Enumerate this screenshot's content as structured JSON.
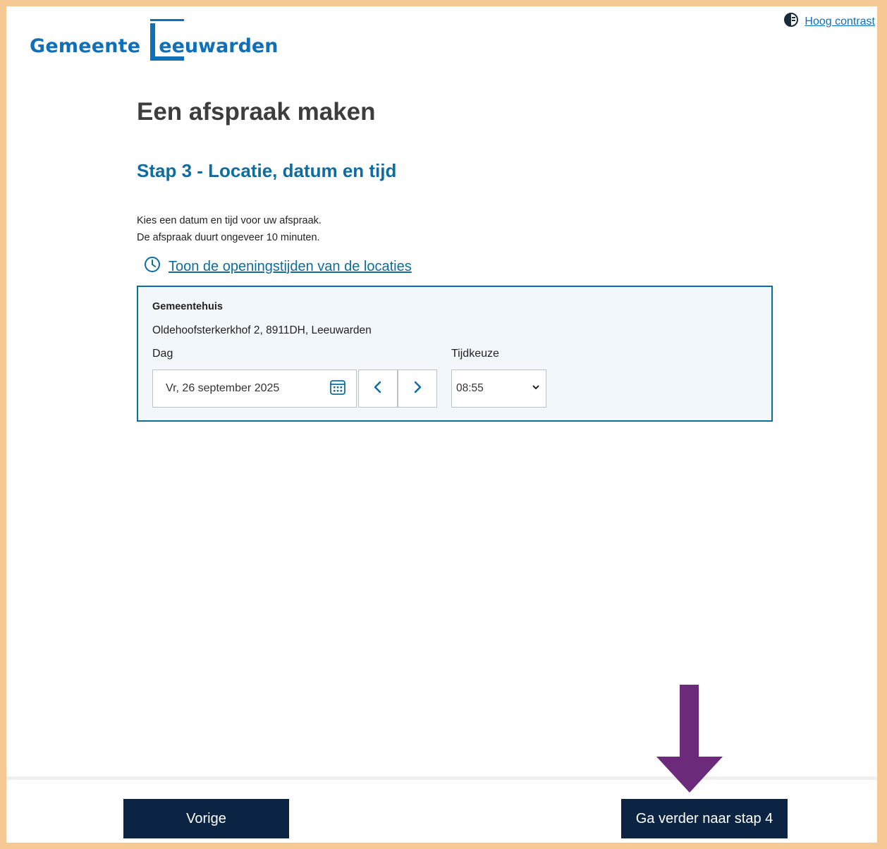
{
  "header": {
    "logo_part1": "Gemeente",
    "logo_part2": "eeuwarden",
    "contrast_link": "Hoog contrast"
  },
  "main": {
    "title": "Een afspraak maken",
    "step_title": "Stap 3 - Locatie, datum en tijd",
    "intro_line1": "Kies een datum en tijd voor uw afspraak.",
    "intro_line2": "De afspraak duurt ongeveer 10 minuten.",
    "hours_link": "Toon de openingstijden van de locaties"
  },
  "location": {
    "name": "Gemeentehuis",
    "address": "Oldehoofsterkerkhof 2, 8911DH, Leeuwarden",
    "day_label": "Dag",
    "day_value": "Vr, 26 september 2025",
    "time_label": "Tijdkeuze",
    "time_value": "08:55"
  },
  "footer": {
    "back_label": "Vorige",
    "next_label": "Ga verder naar stap 4"
  },
  "colors": {
    "brand_blue": "#0f6fb7",
    "heading_blue": "#0e6d9e",
    "button_navy": "#0c2443",
    "annotation_arrow": "#6b2a7a",
    "frame": "#f6c994"
  },
  "icons": [
    "contrast-icon",
    "clock-icon",
    "calendar-icon",
    "chevron-left-icon",
    "chevron-right-icon",
    "chevron-down-icon",
    "down-arrow-annotation"
  ]
}
